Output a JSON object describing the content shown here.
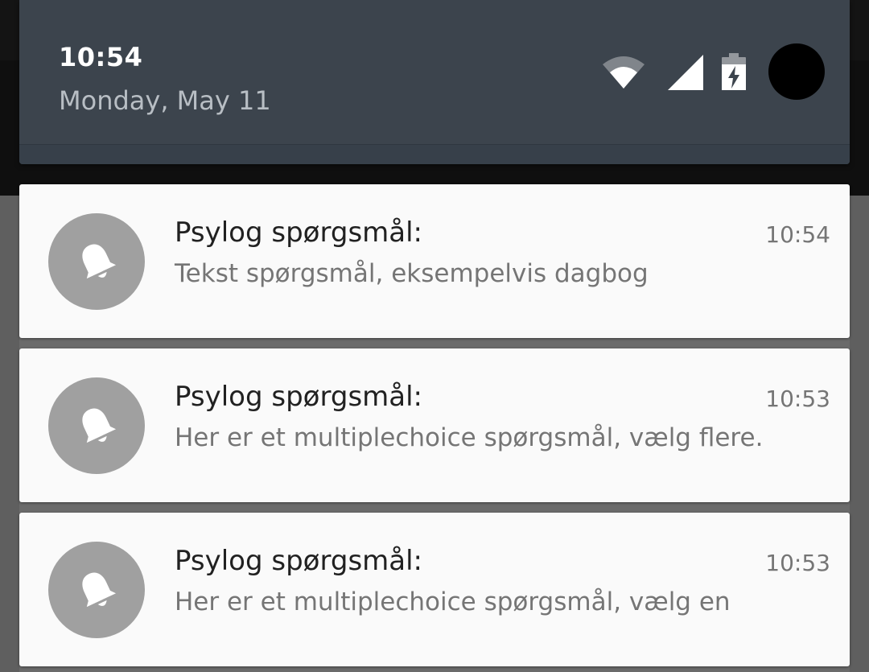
{
  "status": {
    "time": "10:54",
    "date": "Monday, May 11",
    "icons": [
      "wifi-icon",
      "cell-signal-icon",
      "battery-charging-icon",
      "user-avatar"
    ]
  },
  "notifications": [
    {
      "app_icon": "bell-icon",
      "title": "Psylog spørgsmål:",
      "text": "Tekst spørgsmål, eksempelvis dagbog",
      "time": "10:54"
    },
    {
      "app_icon": "bell-icon",
      "title": "Psylog spørgsmål:",
      "text": "Her er et multiplechoice spørgsmål, vælg flere.",
      "time": "10:53"
    },
    {
      "app_icon": "bell-icon",
      "title": "Psylog spørgsmål:",
      "text": "Her er et multiplechoice spørgsmål, vælg en",
      "time": "10:53"
    }
  ],
  "colors": {
    "header_bg": "#3c444d",
    "card_bg": "#fafafa",
    "icon_circle": "#a0a0a0",
    "title_text": "#212121",
    "secondary_text": "#757575"
  }
}
